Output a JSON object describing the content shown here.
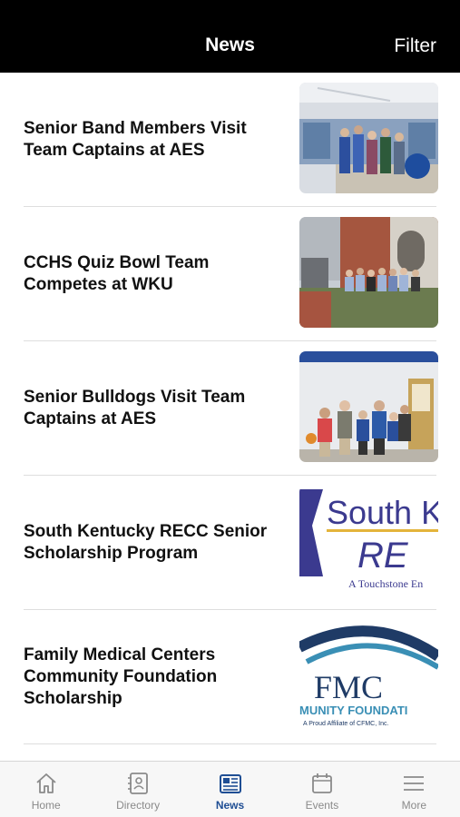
{
  "header": {
    "title": "News",
    "filter_label": "Filter"
  },
  "news": [
    {
      "title": "Senior Band Members Visit Team Captains at AES",
      "image": "group-photo-library"
    },
    {
      "title": "CCHS Quiz Bowl Team Competes at WKU",
      "image": "group-photo-campus-steps"
    },
    {
      "title": "Senior Bulldogs Visit Team Captains at AES",
      "image": "group-photo-hallway"
    },
    {
      "title": "South Kentucky RECC Senior Scholarship Program",
      "image": "south-kentucky-recc-logo",
      "logo": {
        "line1": "South K",
        "line2": "RE",
        "tagline": "A Touchstone En"
      }
    },
    {
      "title": "Family Medical Centers Community Foundation Scholarship",
      "image": "fmc-logo",
      "logo": {
        "mark": "FMC",
        "line2": "MUNITY FOUNDATI",
        "tagline": "A Proud Affiliate of CFMC, Inc."
      }
    }
  ],
  "tabs": [
    {
      "label": "Home",
      "icon": "home-icon"
    },
    {
      "label": "Directory",
      "icon": "directory-icon"
    },
    {
      "label": "News",
      "icon": "news-icon",
      "active": true
    },
    {
      "label": "Events",
      "icon": "calendar-icon"
    },
    {
      "label": "More",
      "icon": "menu-icon"
    }
  ],
  "colors": {
    "header_bg": "#000000",
    "active_tab": "#1f4e94",
    "inactive_tab": "#8a8a8a",
    "logo_purple": "#3b3a8f",
    "fmc_navy": "#1f3b66"
  }
}
